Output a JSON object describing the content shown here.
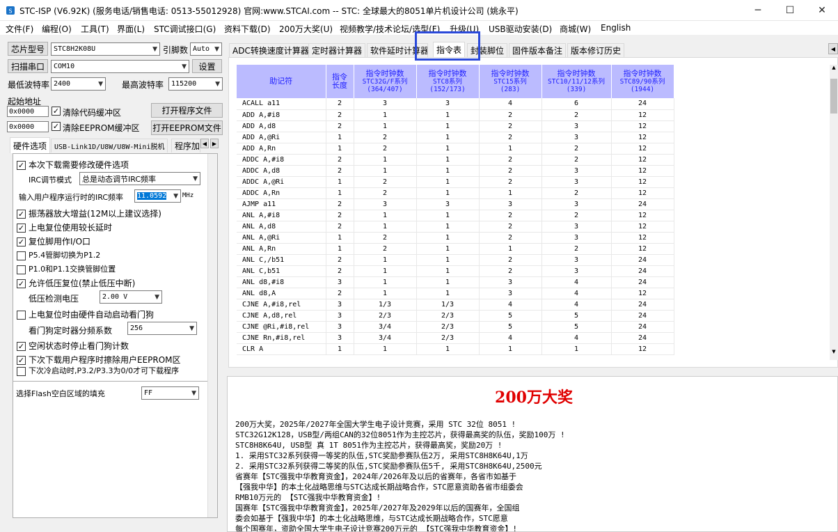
{
  "window": {
    "title": "STC-ISP (V6.92K) (服务电话/销售电话: 0513-55012928) 官网:www.STCAI.com  -- STC: 全球最大的8051单片机设计公司 (姚永平)",
    "minimize": "─",
    "maximize": "☐",
    "close": "✕"
  },
  "menu": [
    "文件(F)",
    "编程(O)",
    "工具(T)",
    "界面(L)",
    "STC调试接口(G)",
    "资料下载(D)",
    "200万大奖(U)",
    "视频教学/技术论坛/选型(F)",
    "升级(U)",
    "USB驱动安装(D)",
    "商城(W)",
    "English"
  ],
  "left": {
    "chip_btn": "芯片型号",
    "chip_value": "STC8H2K08U",
    "pin_label": "引脚数",
    "pin_value": "Auto",
    "scan_btn": "扫描串口",
    "port_value": "COM10",
    "settings_btn": "设置",
    "min_baud_label": "最低波特率",
    "min_baud_value": "2400",
    "max_baud_label": "最高波特率",
    "max_baud_value": "115200",
    "start_addr_label": "起始地址",
    "addr1": "0x0000",
    "clear_code": "清除代码缓冲区",
    "open_prog": "打开程序文件",
    "addr2": "0x0000",
    "clear_eeprom": "清除EEPROM缓冲区",
    "open_eeprom": "打开EEPROM文件",
    "tabs": [
      "硬件选项",
      "USB-Link1D/U8W/U8W-Mini脱机",
      "程序加"
    ],
    "hw": {
      "opt_modify": "本次下载需要修改硬件选项",
      "irc_mode_label": "IRC调节模式",
      "irc_mode_value": "总是动态调节IRC频率",
      "irc_freq_label": "输入用户程序运行时的IRC频率",
      "irc_freq_value": "11.0592",
      "irc_unit": "MHz",
      "opt_osc": "振荡器放大增益(12M以上建议选择)",
      "opt_reset_delay": "上电复位使用较长延时",
      "opt_reset_io": "复位脚用作I/O口",
      "opt_p54": "P5.4管脚切换为P1.2",
      "opt_p10": "P1.0和P1.1交换管脚位置",
      "opt_lvr": "允许低压复位(禁止低压中断)",
      "lv_label": "低压检测电压",
      "lv_value": "2.00 V",
      "opt_wdt": "上电复位时由硬件自动启动看门狗",
      "wdt_div_label": "看门狗定时器分频系数",
      "wdt_div_value": "256",
      "opt_idle_wdt": "空闲状态时停止看门狗计数",
      "opt_erase_eeprom": "下次下载用户程序时擦除用户EEPROM区",
      "opt_p32": "下次冷启动时,P3.2/P3.3为0/0才可下载程序",
      "flash_fill_label": "选择Flash空白区域的填充",
      "flash_fill_value": "FF"
    }
  },
  "right_tabs": [
    "ADC转换速度计算器",
    "定时器计算器",
    "软件延时计算器",
    "指令表",
    "封装脚位",
    "固件版本备注",
    "版本修订历史"
  ],
  "table": {
    "headers": [
      {
        "l1": "助记符",
        "l2": "",
        "l3": ""
      },
      {
        "l1": "指令",
        "l2": "长度",
        "l3": ""
      },
      {
        "l1": "指令时钟数",
        "l2": "STC32G/F系列",
        "l3": "(364/407)"
      },
      {
        "l1": "指令时钟数",
        "l2": "STC8系列",
        "l3": "(152/173)"
      },
      {
        "l1": "指令时钟数",
        "l2": "STC15系列",
        "l3": "(283)"
      },
      {
        "l1": "指令时钟数",
        "l2": "STC10/11/12系列",
        "l3": "(339)"
      },
      {
        "l1": "指令时钟数",
        "l2": "STC89/90系列",
        "l3": "(1944)"
      }
    ],
    "rows": [
      [
        "ACALL a11",
        "2",
        "3",
        "3",
        "4",
        "6",
        "24"
      ],
      [
        "ADD A,#i8",
        "2",
        "1",
        "1",
        "2",
        "2",
        "12"
      ],
      [
        "ADD A,d8",
        "2",
        "1",
        "1",
        "2",
        "3",
        "12"
      ],
      [
        "ADD A,@Ri",
        "1",
        "2",
        "1",
        "2",
        "3",
        "12"
      ],
      [
        "ADD A,Rn",
        "1",
        "2",
        "1",
        "1",
        "2",
        "12"
      ],
      [
        "ADDC A,#i8",
        "2",
        "1",
        "1",
        "2",
        "2",
        "12"
      ],
      [
        "ADDC A,d8",
        "2",
        "1",
        "1",
        "2",
        "3",
        "12"
      ],
      [
        "ADDC A,@Ri",
        "1",
        "2",
        "1",
        "2",
        "3",
        "12"
      ],
      [
        "ADDC A,Rn",
        "1",
        "2",
        "1",
        "1",
        "2",
        "12"
      ],
      [
        "AJMP a11",
        "2",
        "3",
        "3",
        "3",
        "3",
        "24"
      ],
      [
        "ANL A,#i8",
        "2",
        "1",
        "1",
        "2",
        "2",
        "12"
      ],
      [
        "ANL A,d8",
        "2",
        "1",
        "1",
        "2",
        "3",
        "12"
      ],
      [
        "ANL A,@Ri",
        "1",
        "2",
        "1",
        "2",
        "3",
        "12"
      ],
      [
        "ANL A,Rn",
        "1",
        "2",
        "1",
        "1",
        "2",
        "12"
      ],
      [
        "ANL C,/b51",
        "2",
        "1",
        "1",
        "2",
        "3",
        "24"
      ],
      [
        "ANL C,b51",
        "2",
        "1",
        "1",
        "2",
        "3",
        "24"
      ],
      [
        "ANL d8,#i8",
        "3",
        "1",
        "1",
        "3",
        "4",
        "24"
      ],
      [
        "ANL d8,A",
        "2",
        "1",
        "1",
        "3",
        "4",
        "12"
      ],
      [
        "CJNE A,#i8,rel",
        "3",
        "1/3",
        "1/3",
        "4",
        "4",
        "24"
      ],
      [
        "CJNE A,d8,rel",
        "3",
        "2/3",
        "2/3",
        "5",
        "5",
        "24"
      ],
      [
        "CJNE @Ri,#i8,rel",
        "3",
        "3/4",
        "2/3",
        "5",
        "5",
        "24"
      ],
      [
        "CJNE Rn,#i8,rel",
        "3",
        "3/4",
        "2/3",
        "4",
        "4",
        "24"
      ],
      [
        "CLR A",
        "1",
        "1",
        "1",
        "1",
        "1",
        "12"
      ]
    ]
  },
  "notice": {
    "title": "200万大奖",
    "lines": [
      "200万大奖，2025年/2027年全国大学生电子设计竞赛，采用 STC 32位 8051 !",
      "STC32G12K128，USB型/两组CAN的32位8051作为主控芯片，获得最高奖的队伍，奖励100万 !",
      "STC8H8K64U, USB型 真 1T 8051作为主控芯片，获得最高奖，奖励20万 !",
      "1. 采用STC32系列获得一等奖的队伍,STC奖励参赛队伍2万, 采用STC8H8K64U,1万",
      "2. 采用STC32系列获得二等奖的队伍,STC奖励参赛队伍5千, 采用STC8H8K64U,2500元",
      "省赛年【STC强我中华教育资金】，2024年/2026年及以后的省赛年，各省市如基于",
      "【强我中华】的本土化战略思维与STC达成长期战略合作，STC愿意资助各省市组委会",
      "RMB10万元的 【STC强我中华教育资金】!",
      "国赛年【STC强我中华教育资金】，2025年/2027年及2029年以后的国赛年，全国组",
      "委会如基于【强我中华】的本土化战略思维，与STC达成长期战略合作，STC愿意",
      "每个国赛年，资助全国大学生电子设计竞赛200万元的 【STC强我中华教育资金】!"
    ]
  }
}
